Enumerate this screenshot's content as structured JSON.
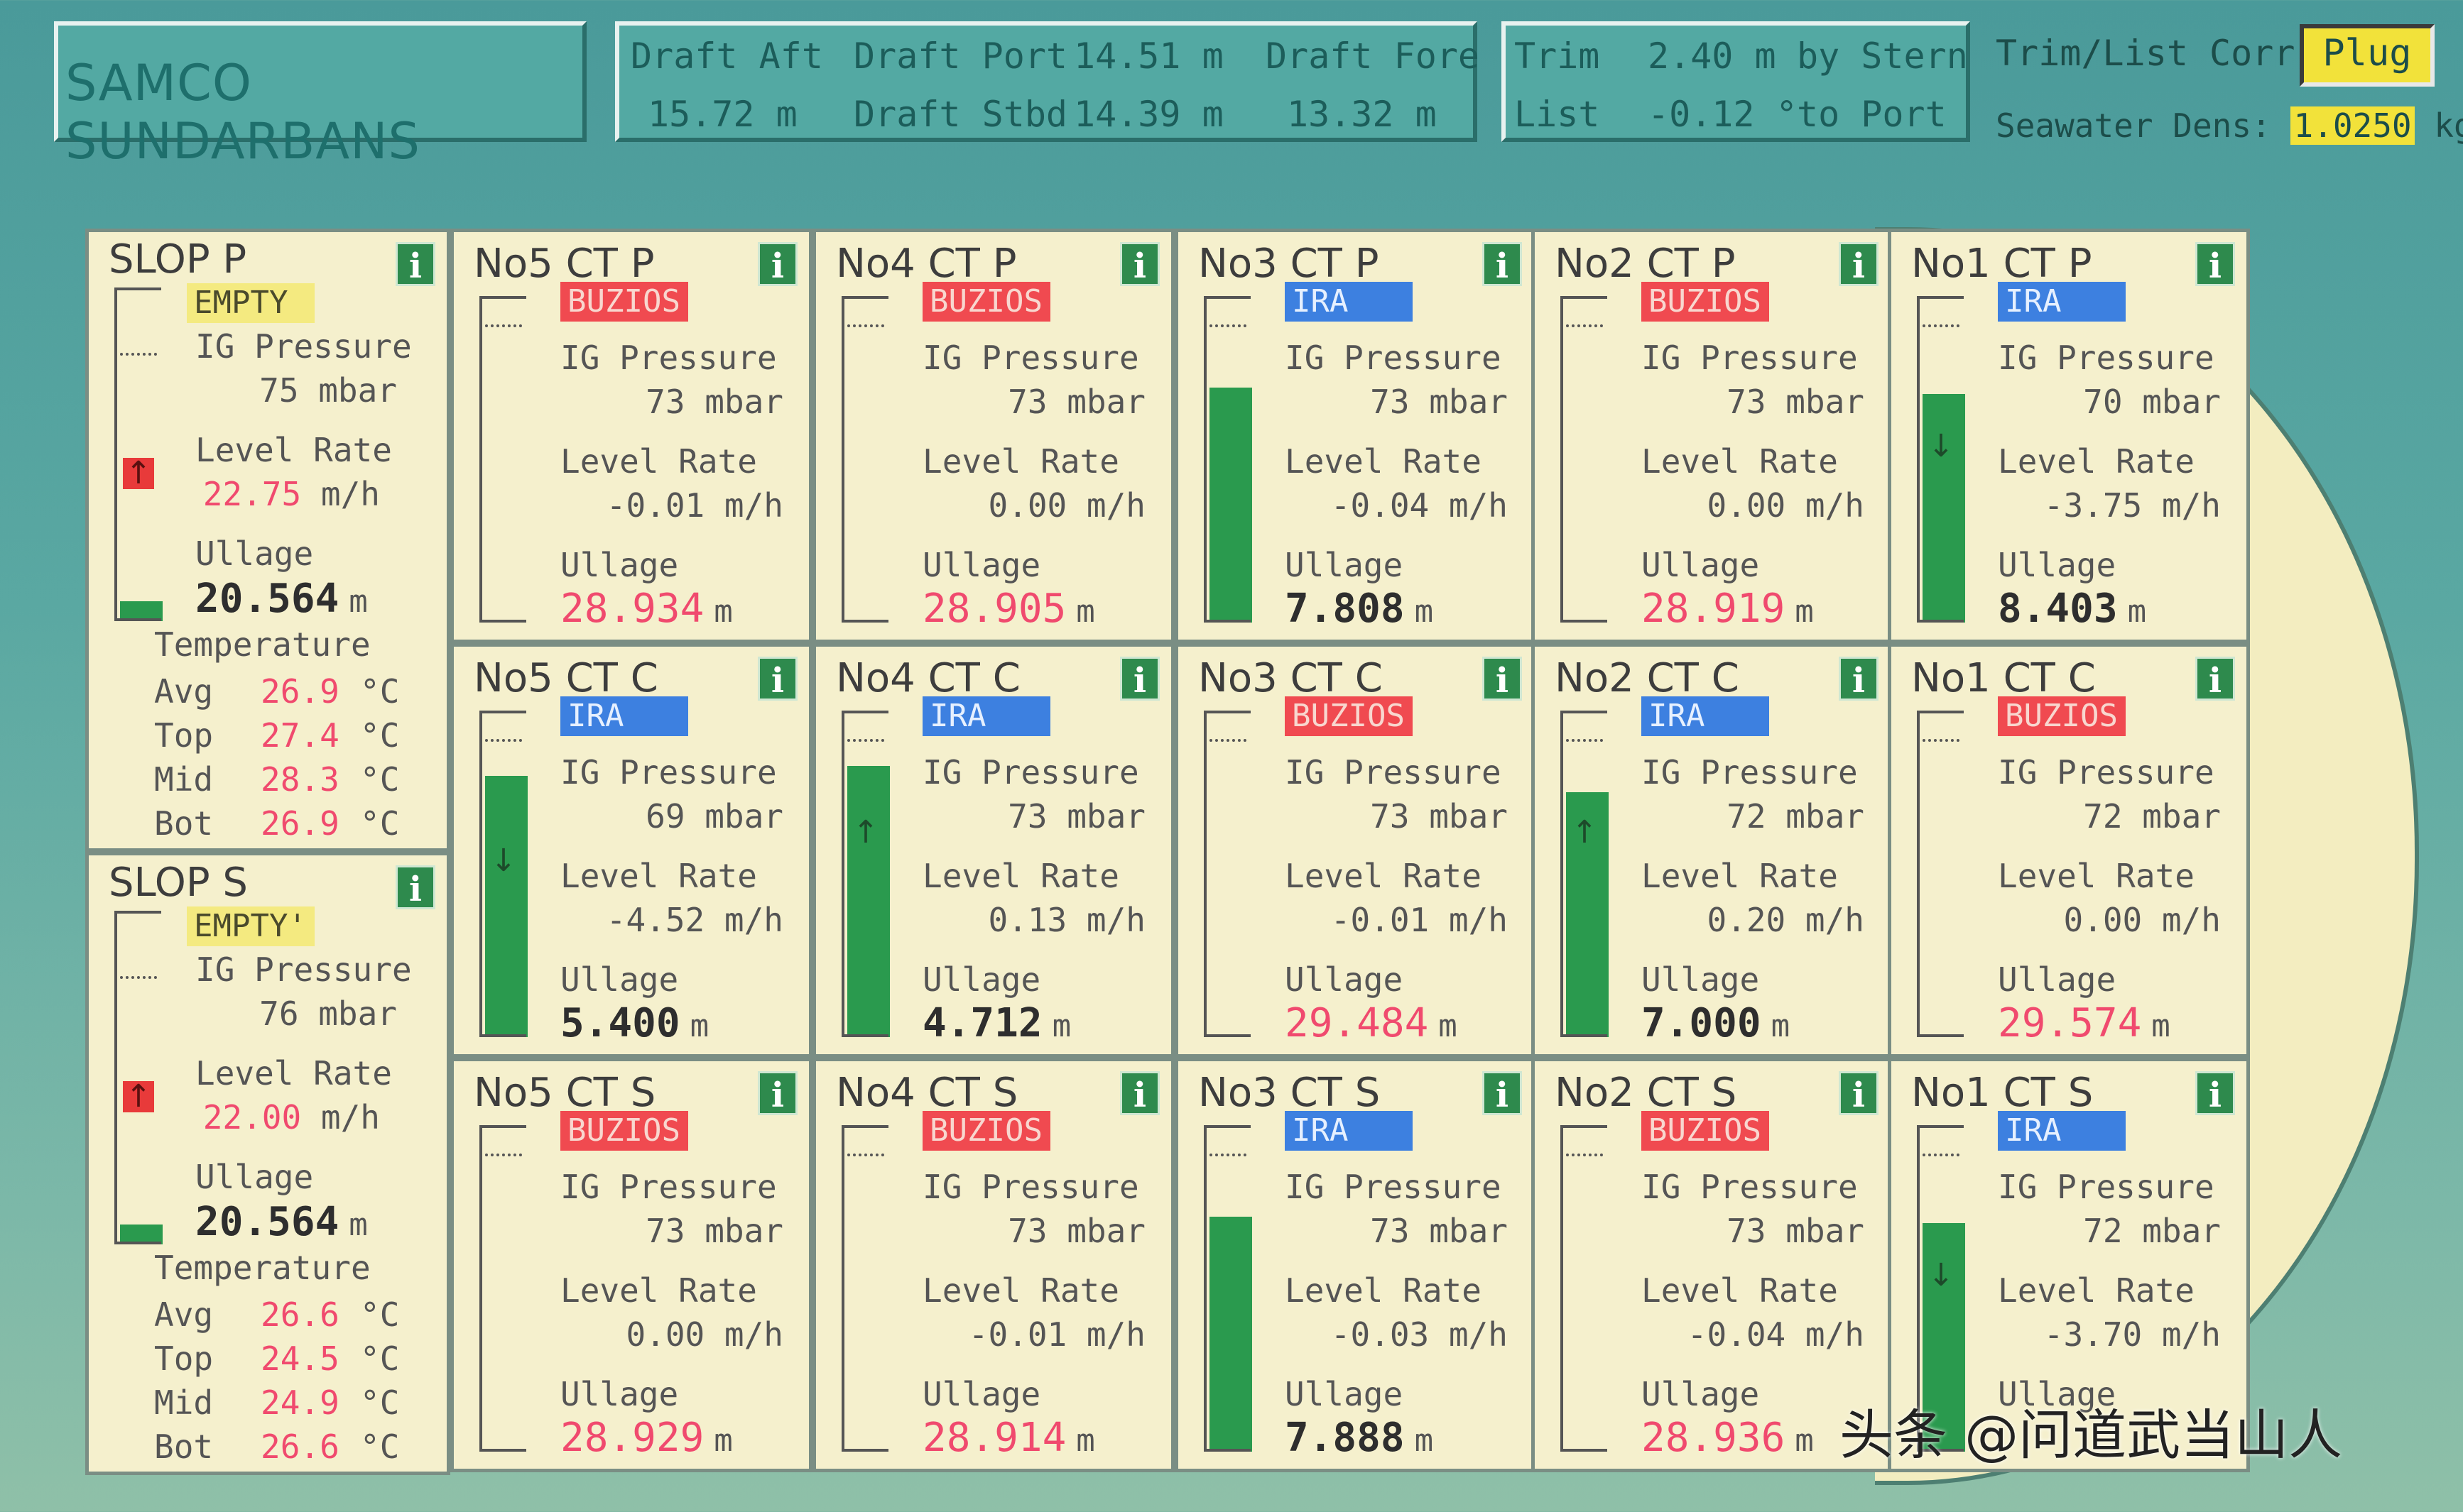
{
  "header": {
    "ship_name": "SAMCO SUNDARBANS",
    "draft_aft_label": "Draft Aft",
    "draft_aft_value": "15.72 m",
    "draft_port_label": "Draft Port",
    "draft_port_value": "14.51 m",
    "draft_stbd_label": "Draft Stbd",
    "draft_stbd_value": "14.39 m",
    "draft_fore_label": "Draft Fore",
    "draft_fore_value": "13.32 m",
    "trim_label": "Trim",
    "trim_value": "2.40 m",
    "trim_dir": "by Stern",
    "list_label": "List",
    "list_value": "-0.12 °",
    "list_dir": "to Port",
    "trim_list_corr_label": "Trim/List Corr:",
    "trim_list_corr_value": "Plug",
    "seawater_dens_label": "Seawater Dens:",
    "seawater_dens_value": "1.0250",
    "seawater_dens_unit": "kg/l"
  },
  "labels": {
    "ig_pressure": "IG Pressure",
    "level_rate": "Level Rate",
    "ullage": "Ullage",
    "temperature": "Temperature",
    "avg": "Avg",
    "top": "Top",
    "mid": "Mid",
    "bot": "Bot",
    "info": "i",
    "m": "m",
    "degc": "°C"
  },
  "slop": {
    "p": {
      "name": "SLOP P",
      "status": "EMPTY",
      "ig_pressure": "75 mbar",
      "level_rate": "22.75",
      "level_rate_unit": "m/h",
      "ullage": "20.564",
      "temp_avg": "26.9",
      "temp_top": "27.4",
      "temp_mid": "28.3",
      "temp_bot": "26.9",
      "fill_level": 0.06
    },
    "s": {
      "name": "SLOP S",
      "status": "EMPTY'",
      "ig_pressure": "76 mbar",
      "level_rate": "22.00",
      "level_rate_unit": "m/h",
      "ullage": "20.564",
      "temp_avg": "26.6",
      "temp_top": "24.5",
      "temp_mid": "24.9",
      "temp_bot": "26.6",
      "fill_level": 0.06
    }
  },
  "tanks": [
    {
      "name": "No5 CT P",
      "cargo": "BUZIOS",
      "ig": "73 mbar",
      "rate": "-0.01 m/h",
      "ullage": "28.934",
      "ullage_red": true,
      "fill": 0.0,
      "arrow": ""
    },
    {
      "name": "No4 CT P",
      "cargo": "BUZIOS",
      "ig": "73 mbar",
      "rate": "0.00 m/h",
      "ullage": "28.905",
      "ullage_red": true,
      "fill": 0.0,
      "arrow": ""
    },
    {
      "name": "No3 CT P",
      "cargo": "IRA",
      "ig": "73 mbar",
      "rate": "-0.04 m/h",
      "ullage": "7.808",
      "ullage_red": false,
      "fill": 0.72,
      "arrow": ""
    },
    {
      "name": "No2 CT P",
      "cargo": "BUZIOS",
      "ig": "73 mbar",
      "rate": "0.00 m/h",
      "ullage": "28.919",
      "ullage_red": true,
      "fill": 0.0,
      "arrow": ""
    },
    {
      "name": "No1 CT P",
      "cargo": "IRA",
      "ig": "70 mbar",
      "rate": "-3.75 m/h",
      "ullage": "8.403",
      "ullage_red": false,
      "fill": 0.7,
      "arrow": "down"
    },
    {
      "name": "No5 CT C",
      "cargo": "IRA",
      "ig": "69 mbar",
      "rate": "-4.52 m/h",
      "ullage": "5.400",
      "ullage_red": false,
      "fill": 0.8,
      "arrow": "down"
    },
    {
      "name": "No4 CT C",
      "cargo": "IRA",
      "ig": "73 mbar",
      "rate": "0.13 m/h",
      "ullage": "4.712",
      "ullage_red": false,
      "fill": 0.83,
      "arrow": "up"
    },
    {
      "name": "No3 CT C",
      "cargo": "BUZIOS",
      "ig": "73 mbar",
      "rate": "-0.01 m/h",
      "ullage": "29.484",
      "ullage_red": true,
      "fill": 0.0,
      "arrow": ""
    },
    {
      "name": "No2 CT C",
      "cargo": "IRA",
      "ig": "72 mbar",
      "rate": "0.20 m/h",
      "ullage": "7.000",
      "ullage_red": false,
      "fill": 0.75,
      "arrow": "up"
    },
    {
      "name": "No1 CT C",
      "cargo": "BUZIOS",
      "ig": "72 mbar",
      "rate": "0.00 m/h",
      "ullage": "29.574",
      "ullage_red": true,
      "fill": 0.0,
      "arrow": ""
    },
    {
      "name": "No5 CT S",
      "cargo": "BUZIOS",
      "ig": "73 mbar",
      "rate": "0.00 m/h",
      "ullage": "28.929",
      "ullage_red": true,
      "fill": 0.0,
      "arrow": ""
    },
    {
      "name": "No4 CT S",
      "cargo": "BUZIOS",
      "ig": "73 mbar",
      "rate": "-0.01 m/h",
      "ullage": "28.914",
      "ullage_red": true,
      "fill": 0.0,
      "arrow": ""
    },
    {
      "name": "No3 CT S",
      "cargo": "IRA",
      "ig": "73 mbar",
      "rate": "-0.03 m/h",
      "ullage": "7.888",
      "ullage_red": false,
      "fill": 0.72,
      "arrow": ""
    },
    {
      "name": "No2 CT S",
      "cargo": "BUZIOS",
      "ig": "73 mbar",
      "rate": "-0.04 m/h",
      "ullage": "28.936",
      "ullage_red": true,
      "fill": 0.0,
      "arrow": ""
    },
    {
      "name": "No1 CT S",
      "cargo": "IRA",
      "ig": "72 mbar",
      "rate": "-3.70 m/h",
      "ullage": "",
      "ullage_red": false,
      "fill": 0.7,
      "arrow": "down"
    }
  ],
  "watermark": "头条 @问道武当山人"
}
